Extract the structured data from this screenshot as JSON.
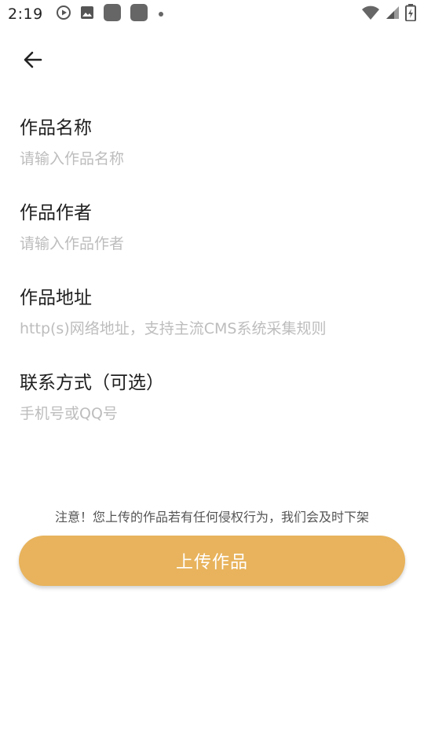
{
  "status_bar": {
    "time": "2:19"
  },
  "header": {
    "back_icon": "arrow-left-icon"
  },
  "form": {
    "fields": [
      {
        "label": "作品名称",
        "value": "",
        "placeholder": "请输入作品名称"
      },
      {
        "label": "作品作者",
        "value": "",
        "placeholder": "请输入作品作者"
      },
      {
        "label": "作品地址",
        "value": "",
        "placeholder": "http(s)网络地址，支持主流CMS系统采集规则"
      },
      {
        "label": "联系方式（可选）",
        "value": "",
        "placeholder": "手机号或QQ号"
      }
    ]
  },
  "notice": "注意！您上传的作品若有任何侵权行为，我们会及时下架",
  "submit_label": "上传作品",
  "colors": {
    "accent": "#e8b35c",
    "placeholder": "#bdbdbd",
    "label": "#1f1f1f"
  }
}
